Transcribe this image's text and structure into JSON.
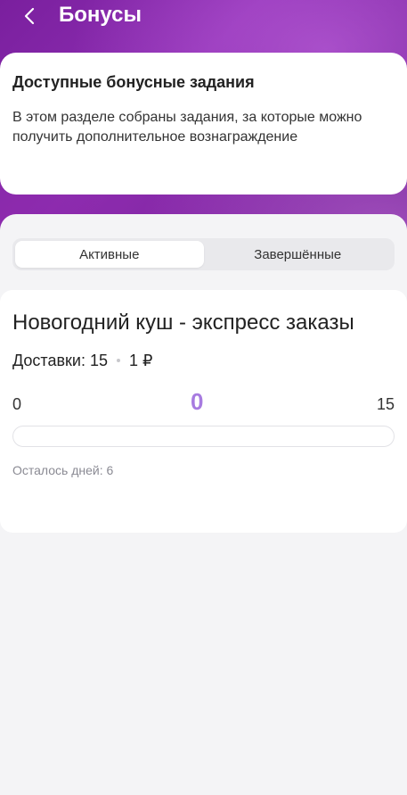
{
  "header": {
    "title": "Бонусы",
    "back_icon": "chevron-left-icon"
  },
  "info_card": {
    "title": "Доступные бонусные задания",
    "text": "В этом разделе собраны задания, за которые можно получить дополнительное вознаграждение"
  },
  "tabs": [
    {
      "label": "Активные",
      "active": true
    },
    {
      "label": "Завершённые",
      "active": false
    }
  ],
  "task": {
    "title": "Новогодний куш - экспресс заказы",
    "deliveries_label": "Доставки:",
    "deliveries_value": "15",
    "reward": "1 ₽",
    "progress_min": "0",
    "progress_current": "0",
    "progress_max": "15",
    "progress_fraction": 0,
    "days_left": "Осталось дней: 6"
  },
  "colors": {
    "accent": "#a77be0",
    "hero_purple": "#7a1f9e",
    "background": "#f4f4f6"
  }
}
